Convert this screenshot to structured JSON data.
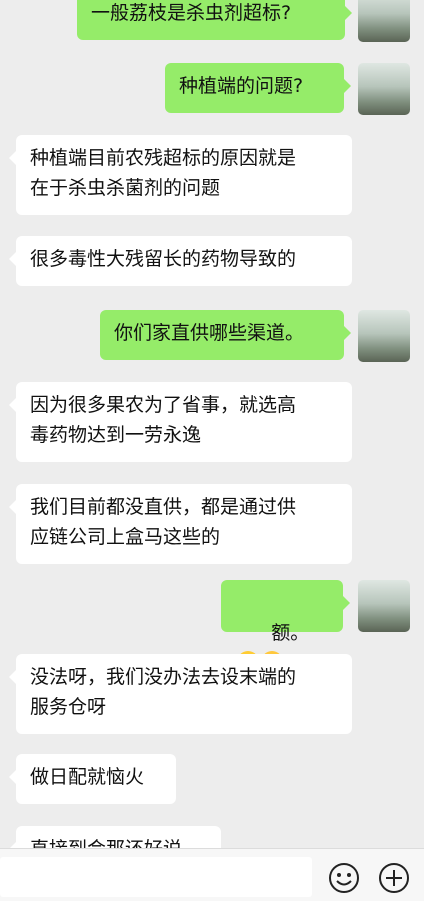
{
  "messages": [
    {
      "side": "right",
      "text": "一般荔枝是杀虫剂超标?"
    },
    {
      "side": "right",
      "text": "种植端的问题?"
    },
    {
      "side": "left",
      "text": "种植端目前农残超标的原因就是\n在于杀虫杀菌剂的问题"
    },
    {
      "side": "left",
      "text": "很多毒性大残留长的药物导致的"
    },
    {
      "side": "right",
      "text": "你们家直供哪些渠道。"
    },
    {
      "side": "left",
      "text": "因为很多果农为了省事，就选高\n毒药物达到一劳永逸"
    },
    {
      "side": "left",
      "text": "我们目前都没直供，都是通过供\n应链公司上盒马这些的"
    },
    {
      "side": "right",
      "text": "额。",
      "emojis": [
        "thinking-face-icon",
        "laughing-crying-face-icon"
      ]
    },
    {
      "side": "left",
      "text": "没法呀，我们没办法去设末端的\n服务仓呀"
    },
    {
      "side": "left",
      "text": "做日配就恼火"
    },
    {
      "side": "left",
      "text": "直接到会那还好说"
    }
  ],
  "input": {
    "value": "",
    "placeholder": ""
  },
  "icons": {
    "emoji": "smiley-face-icon",
    "more": "plus-circle-icon"
  },
  "colors": {
    "background": "#ededed",
    "sent_bubble": "#95ec69",
    "received_bubble": "#ffffff"
  }
}
